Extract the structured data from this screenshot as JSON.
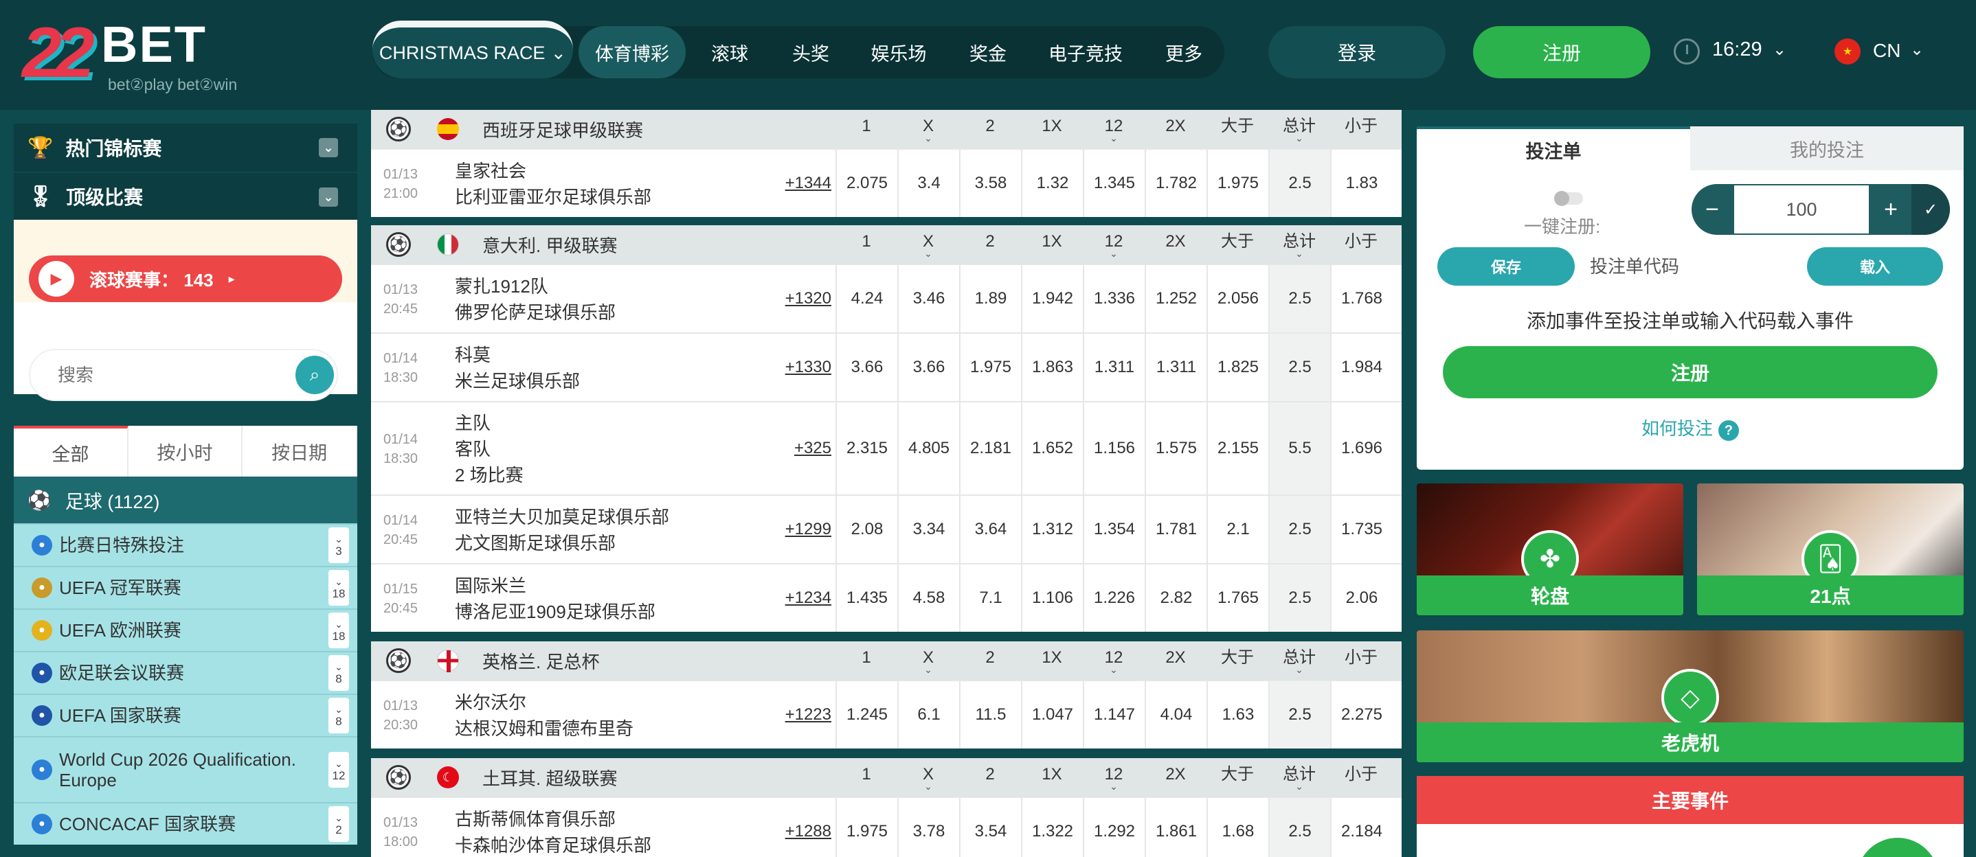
{
  "brand": {
    "logo_num": "22",
    "logo_text": "BET",
    "tagline": "bet②play  bet②win"
  },
  "nav": {
    "christmas": "CHRISTMAS RACE",
    "items": [
      "体育博彩",
      "滚球",
      "头奖",
      "娱乐场",
      "奖金",
      "电子竞技",
      "更多"
    ],
    "login": "登录",
    "register": "注册",
    "time": "16:29",
    "lang": "CN"
  },
  "sidebar": {
    "hot": "热门锦标赛",
    "top": "顶级比赛",
    "live_label": "滚球赛事： 143",
    "search_placeholder": "搜索",
    "filters": [
      "全部",
      "按小时",
      "按日期"
    ],
    "sport": "足球 (1122)",
    "leagues": [
      {
        "name": "比赛日特殊投注",
        "count": "3",
        "color": "#2b7fd6"
      },
      {
        "name": "UEFA 冠军联赛",
        "count": "18",
        "color": "#c89b2a"
      },
      {
        "name": "UEFA 欧洲联赛",
        "count": "18",
        "color": "#e3b21d"
      },
      {
        "name": "欧足联会议联赛",
        "count": "8",
        "color": "#2054a8"
      },
      {
        "name": "UEFA 国家联赛",
        "count": "8",
        "color": "#2054a8"
      },
      {
        "name": "World Cup 2026 Qualification. Europe",
        "count": "12",
        "color": "#2b7fd6"
      },
      {
        "name": "CONCACAF 国家联赛",
        "count": "2",
        "color": "#2b7fd6"
      }
    ]
  },
  "odds_headers": [
    "1",
    "X",
    "2",
    "1X",
    "12",
    "2X",
    "大于",
    "总计",
    "小于"
  ],
  "sections": [
    {
      "league": "西班牙足球甲级联赛",
      "flag": "es",
      "matches": [
        {
          "date": "01/13",
          "time": "21:00",
          "teams": [
            "皇家社会",
            "比利亚雷亚尔足球俱乐部"
          ],
          "more": "+1344",
          "odds": [
            "2.075",
            "3.4",
            "3.58",
            "1.32",
            "1.345",
            "1.782",
            "1.975",
            "2.5",
            "1.83"
          ]
        }
      ]
    },
    {
      "league": "意大利. 甲级联赛",
      "flag": "it",
      "matches": [
        {
          "date": "01/13",
          "time": "20:45",
          "teams": [
            "蒙扎1912队",
            "佛罗伦萨足球俱乐部"
          ],
          "more": "+1320",
          "odds": [
            "4.24",
            "3.46",
            "1.89",
            "1.942",
            "1.336",
            "1.252",
            "2.056",
            "2.5",
            "1.768"
          ]
        },
        {
          "date": "01/14",
          "time": "18:30",
          "teams": [
            "科莫",
            "米兰足球俱乐部"
          ],
          "more": "+1330",
          "odds": [
            "3.66",
            "3.66",
            "1.975",
            "1.863",
            "1.311",
            "1.311",
            "1.825",
            "2.5",
            "1.984"
          ]
        },
        {
          "date": "01/14",
          "time": "18:30",
          "teams": [
            "主队",
            "客队",
            "2 场比赛"
          ],
          "more": "+325",
          "odds": [
            "2.315",
            "4.805",
            "2.181",
            "1.652",
            "1.156",
            "1.575",
            "2.155",
            "5.5",
            "1.696"
          ]
        },
        {
          "date": "01/14",
          "time": "20:45",
          "teams": [
            "亚特兰大贝加莫足球俱乐部",
            "尤文图斯足球俱乐部"
          ],
          "more": "+1299",
          "odds": [
            "2.08",
            "3.34",
            "3.64",
            "1.312",
            "1.354",
            "1.781",
            "2.1",
            "2.5",
            "1.735"
          ]
        },
        {
          "date": "01/15",
          "time": "20:45",
          "teams": [
            "国际米兰",
            "博洛尼亚1909足球俱乐部"
          ],
          "more": "+1234",
          "odds": [
            "1.435",
            "4.58",
            "7.1",
            "1.106",
            "1.226",
            "2.82",
            "1.765",
            "2.5",
            "2.06"
          ]
        }
      ]
    },
    {
      "league": "英格兰. 足总杯",
      "flag": "en",
      "matches": [
        {
          "date": "01/13",
          "time": "20:30",
          "teams": [
            "米尔沃尔",
            "达根汉姆和雷德布里奇"
          ],
          "more": "+1223",
          "odds": [
            "1.245",
            "6.1",
            "11.5",
            "1.047",
            "1.147",
            "4.04",
            "1.63",
            "2.5",
            "2.275"
          ]
        }
      ]
    },
    {
      "league": "土耳其. 超级联赛",
      "flag": "tr",
      "matches": [
        {
          "date": "01/13",
          "time": "18:00",
          "teams": [
            "古斯蒂佩体育俱乐部",
            "卡森帕沙体育足球俱乐部"
          ],
          "more": "+1288",
          "odds": [
            "1.975",
            "3.78",
            "3.54",
            "1.322",
            "1.292",
            "1.861",
            "1.68",
            "2.5",
            "2.184"
          ]
        }
      ]
    }
  ],
  "betslip": {
    "tab1": "投注单",
    "tab2": "我的投注",
    "one_click": "一键注册:",
    "stake": "100",
    "save": "保存",
    "code_placeholder": "投注单代码",
    "load": "载入",
    "hint": "添加事件至投注单或输入代码载入事件",
    "register": "注册",
    "how": "如何投注"
  },
  "games": {
    "roulette": "轮盘",
    "blackjack": "21点",
    "slots": "老虎机"
  },
  "main_events": "主要事件"
}
